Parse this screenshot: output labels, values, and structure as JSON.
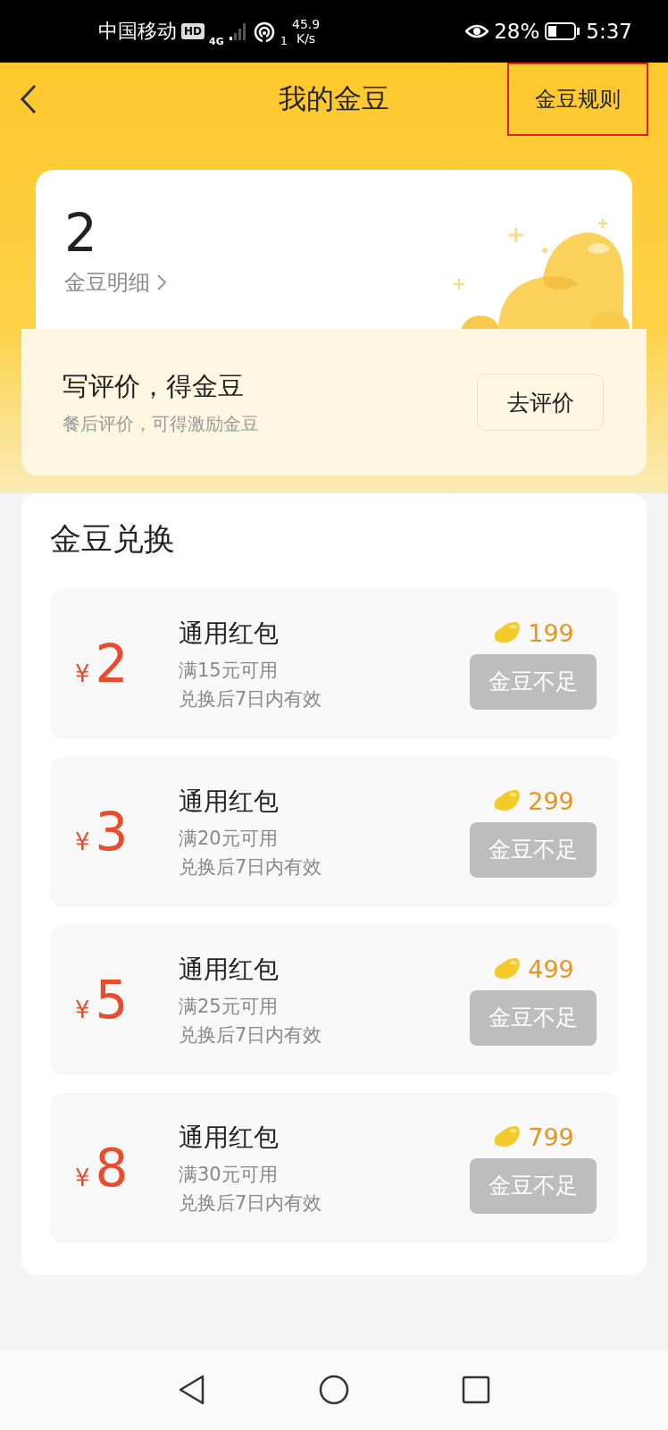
{
  "status_bar": {
    "carrier": "中国移动",
    "hd": "HD",
    "network": "4G",
    "wifi_sup": "1",
    "speed_value": "45.9",
    "speed_unit": "K/s",
    "battery_percent": "28%",
    "time": "5:37"
  },
  "header": {
    "title": "我的金豆",
    "rules_link": {
      "label": "金豆规则",
      "highlighted": true
    }
  },
  "balance": {
    "value": "2",
    "detail_link": "金豆明细"
  },
  "review_banner": {
    "title": "写评价，得金豆",
    "subtitle": "餐后评价，可得激励金豆",
    "button": "去评价"
  },
  "exchange": {
    "title": "金豆兑换",
    "items": [
      {
        "currency": "¥",
        "amount": "2",
        "name": "通用红包",
        "condition": "满15元可用",
        "validity": "兑换后7日内有效",
        "cost": "199",
        "button": "金豆不足",
        "disabled": true
      },
      {
        "currency": "¥",
        "amount": "3",
        "name": "通用红包",
        "condition": "满20元可用",
        "validity": "兑换后7日内有效",
        "cost": "299",
        "button": "金豆不足",
        "disabled": true
      },
      {
        "currency": "¥",
        "amount": "5",
        "name": "通用红包",
        "condition": "满25元可用",
        "validity": "兑换后7日内有效",
        "cost": "499",
        "button": "金豆不足",
        "disabled": true
      },
      {
        "currency": "¥",
        "amount": "8",
        "name": "通用红包",
        "condition": "满30元可用",
        "validity": "兑换后7日内有效",
        "cost": "799",
        "button": "金豆不足",
        "disabled": true
      }
    ]
  }
}
